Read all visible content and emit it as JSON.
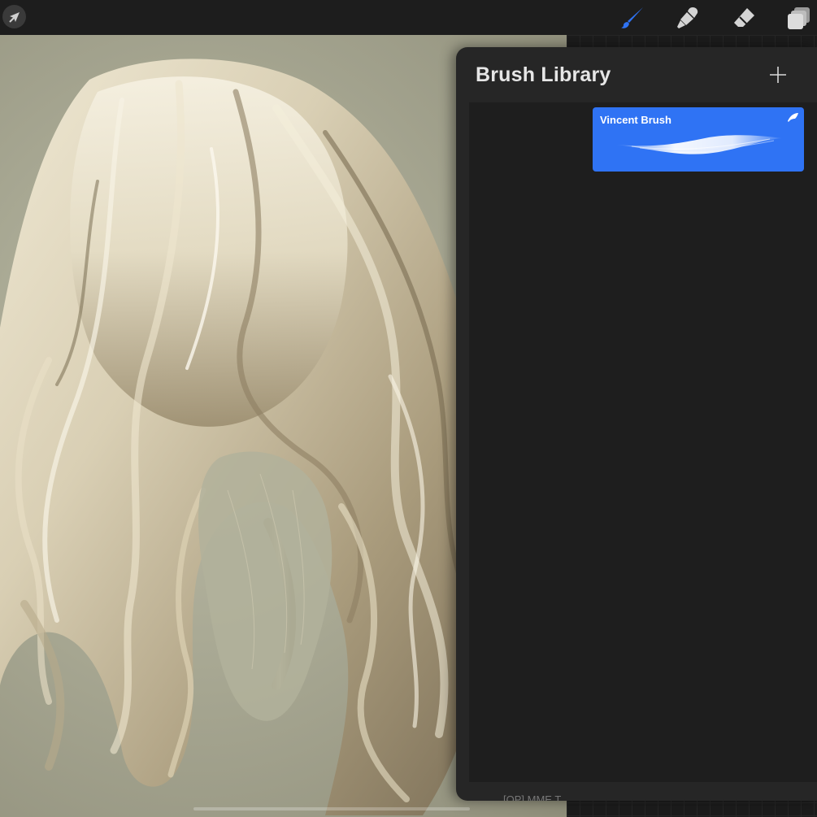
{
  "toolbar": {
    "tools": [
      {
        "name": "brush",
        "icon": "brush-icon",
        "active": true
      },
      {
        "name": "smudge",
        "icon": "smudge-icon",
        "active": false
      },
      {
        "name": "eraser",
        "icon": "eraser-icon",
        "active": false
      },
      {
        "name": "layers",
        "icon": "layers-icon",
        "active": false
      }
    ],
    "accent_color": "#2f73f4",
    "modify_icon": "arrow-cursor-icon"
  },
  "brush_library": {
    "title": "Brush Library",
    "add_icon": "plus-icon",
    "brushes": [
      {
        "name": "Vincent Brush",
        "selected": true,
        "icon": "feather-icon"
      }
    ],
    "footer_text": "[OP] MME T"
  },
  "canvas": {
    "content": "painted-wavy-blonde-hair"
  },
  "colors": {
    "panel_bg": "#262626",
    "list_bg": "#1e1e1e",
    "selection": "#2f73f4"
  }
}
